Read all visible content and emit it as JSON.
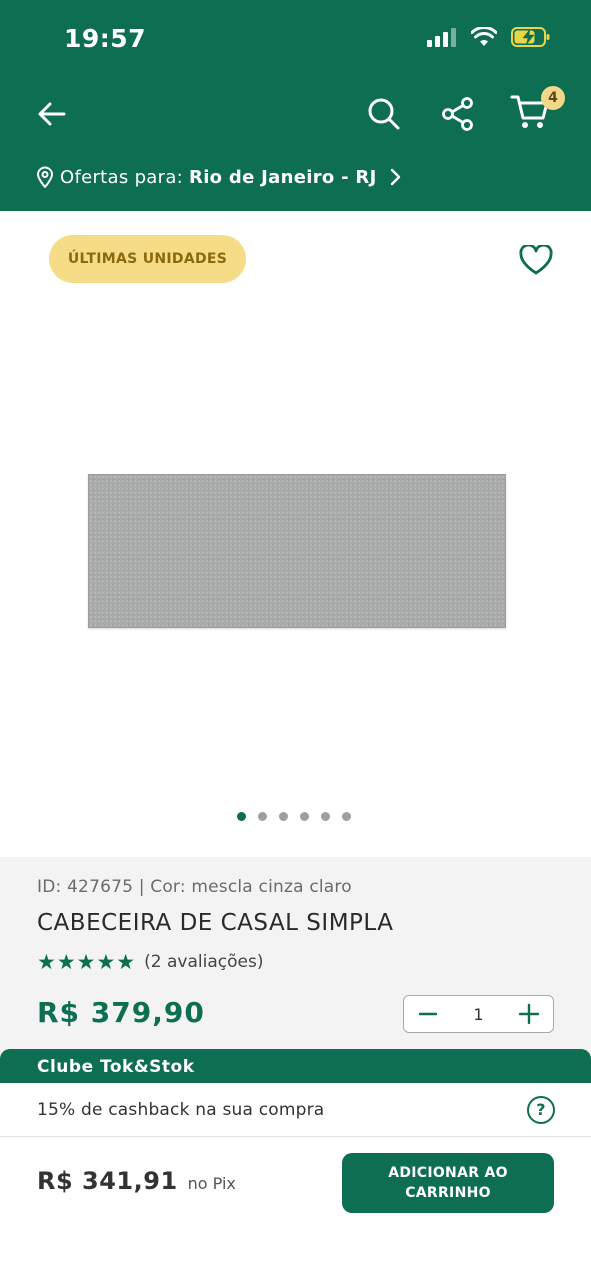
{
  "status_bar": {
    "time": "19:57"
  },
  "header": {
    "cart_count": "4",
    "location": {
      "label": "Ofertas para:",
      "city": "Rio de Janeiro - RJ"
    }
  },
  "product": {
    "badge": "ÚLTIMAS UNIDADES",
    "image_count": 6,
    "active_image_index": 0,
    "meta": "ID: 427675 | Cor: mescla cinza claro",
    "title": "CABECEIRA DE CASAL SIMPLA",
    "stars": "★★★★★",
    "reviews": "(2 avaliações)",
    "price": "R$ 379,90",
    "quantity": "1"
  },
  "clube": {
    "title": "Clube Tok&Stok",
    "cashback": "15% de cashback na sua compra",
    "help_label": "?"
  },
  "footer": {
    "pix_price": "R$ 341,91",
    "pix_label": "no Pix",
    "add_to_cart": "ADICIONAR AO CARRINHO"
  },
  "colors": {
    "brand_green": "#0e6e52",
    "badge_yellow": "#f6dc86",
    "cart_badge": "#f3d88a",
    "battery_charging": "#e8d548"
  }
}
